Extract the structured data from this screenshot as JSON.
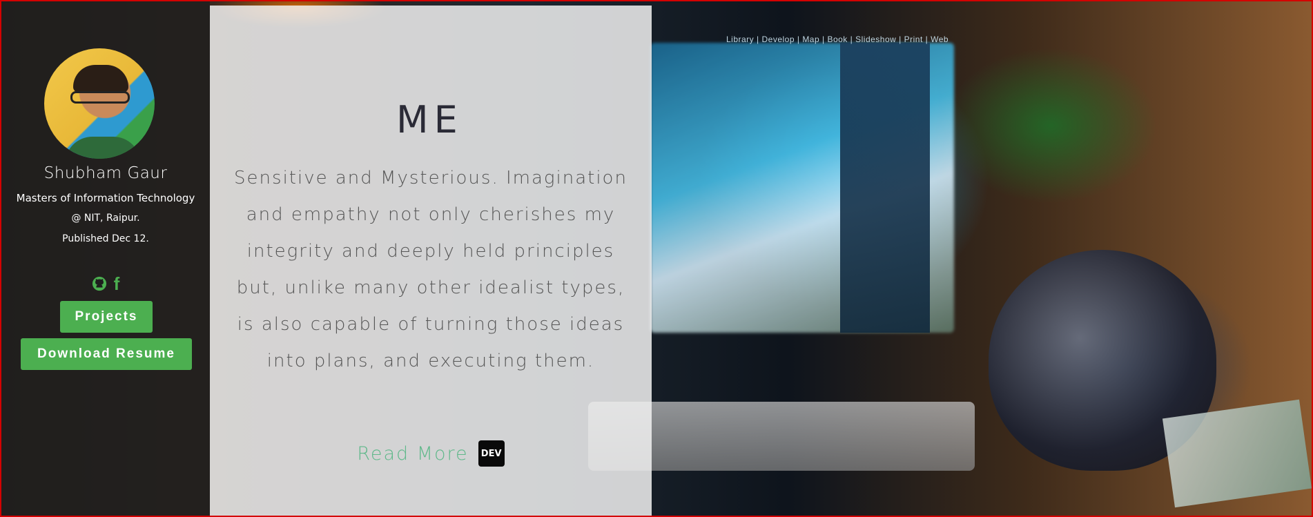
{
  "background": {
    "app_nav": [
      "Library",
      "Develop",
      "Map",
      "Book",
      "Slideshow",
      "Print",
      "Web"
    ]
  },
  "profile": {
    "name": "Shubham Gaur",
    "degree": "Masters of Information Technology",
    "institute": "@ NIT, Raipur.",
    "published": "Published Dec 12."
  },
  "social": {
    "icons": [
      "github-icon",
      "facebook-icon"
    ],
    "facebook_glyph": "f"
  },
  "buttons": {
    "projects": "Projects",
    "resume": "Download Resume"
  },
  "card": {
    "title": "ME",
    "bio": "Sensitive and Mysterious. Imagination and empathy not only cherishes my integrity and deeply held principles but, unlike many other idealist types, is also capable of turning those ideas into plans, and executing them.",
    "read_more": "Read More",
    "dev_badge": "DEV"
  },
  "colors": {
    "accent_green": "#4caf50",
    "link_green": "#5fb88a",
    "sidebar_bg": "#1e1e1e",
    "card_bg": "#f0f0f0",
    "frame_border": "#d40000"
  }
}
